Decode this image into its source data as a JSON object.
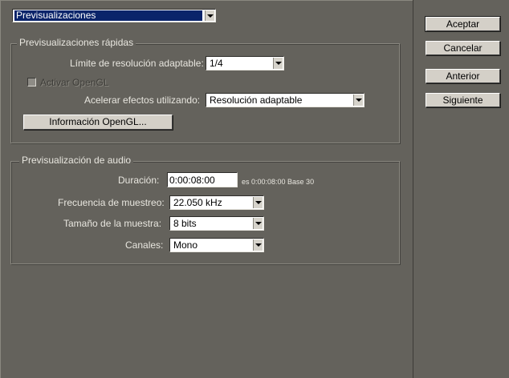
{
  "header": {
    "section_select_value": "Previsualizaciones"
  },
  "quick_previews": {
    "title": "Previsualizaciones rápidas",
    "resolution_limit_label": "Límite de resolución adaptable:",
    "resolution_limit_value": "1/4",
    "opengl_checkbox_label": "Activar OpenGL",
    "opengl_checked": false,
    "accelerate_label": "Acelerar efectos utilizando:",
    "accelerate_value": "Resolución adaptable",
    "opengl_info_button": "Información OpenGL..."
  },
  "audio_preview": {
    "title": "Previsualización de audio",
    "duration_label": "Duración:",
    "duration_value": "0:00:08:00",
    "duration_info": "es 0:00:08:00  Base 30",
    "sample_rate_label": "Frecuencia de muestreo:",
    "sample_rate_value": "22.050 kHz",
    "sample_size_label": "Tamaño de la muestra:",
    "sample_size_value": "8 bits",
    "channels_label": "Canales:",
    "channels_value": "Mono"
  },
  "buttons": {
    "ok": "Aceptar",
    "cancel": "Cancelar",
    "previous": "Anterior",
    "next": "Siguiente"
  }
}
